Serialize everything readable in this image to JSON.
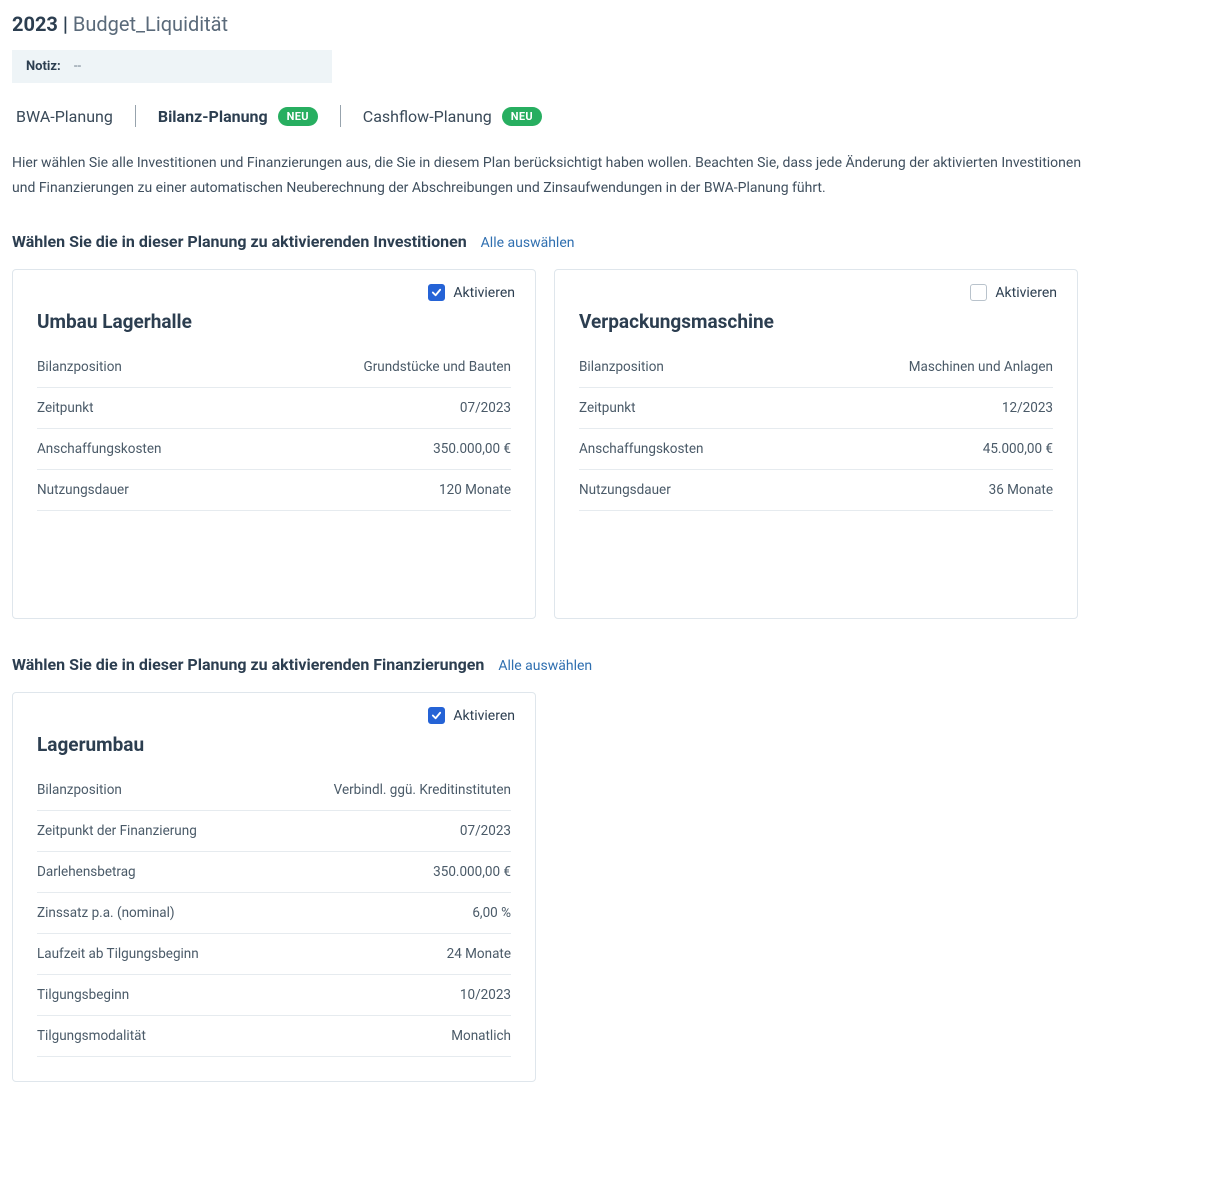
{
  "header": {
    "year": "2023",
    "sep": " | ",
    "title": "Budget_Liquidität",
    "note_label": "Notiz:",
    "note_value": "--"
  },
  "tabs": [
    {
      "label": "BWA-Planung",
      "active": false,
      "badge": null
    },
    {
      "label": "Bilanz-Planung",
      "active": true,
      "badge": "NEU"
    },
    {
      "label": "Cashflow-Planung",
      "active": false,
      "badge": "NEU"
    }
  ],
  "intro": "Hier wählen Sie alle Investitionen und Finanzierungen aus, die Sie in diesem Plan berücksichtigt haben wollen. Beachten Sie, dass jede Änderung der aktivierten Investitionen und Finanzierungen zu einer automatischen Neuberechnung der Abschreibungen und Zinsaufwendungen in der BWA-Planung führt.",
  "sections": {
    "investments": {
      "heading": "Wählen Sie die in dieser Planung zu aktivierenden Investitionen",
      "select_all": "Alle auswählen",
      "activate_label": "Aktivieren",
      "cards": [
        {
          "title": "Umbau Lagerhalle",
          "checked": true,
          "rows": [
            {
              "k": "Bilanzposition",
              "v": "Grundstücke und Bauten"
            },
            {
              "k": "Zeitpunkt",
              "v": "07/2023"
            },
            {
              "k": "Anschaffungskosten",
              "v": "350.000,00 €"
            },
            {
              "k": "Nutzungsdauer",
              "v": "120 Monate"
            }
          ]
        },
        {
          "title": "Verpackungsmaschine",
          "checked": false,
          "rows": [
            {
              "k": "Bilanzposition",
              "v": "Maschinen und Anlagen"
            },
            {
              "k": "Zeitpunkt",
              "v": "12/2023"
            },
            {
              "k": "Anschaffungskosten",
              "v": "45.000,00 €"
            },
            {
              "k": "Nutzungsdauer",
              "v": "36 Monate"
            }
          ]
        }
      ]
    },
    "financings": {
      "heading": "Wählen Sie die in dieser Planung zu aktivierenden Finanzierungen",
      "select_all": "Alle auswählen",
      "activate_label": "Aktivieren",
      "cards": [
        {
          "title": "Lagerumbau",
          "checked": true,
          "rows": [
            {
              "k": "Bilanzposition",
              "v": "Verbindl. ggü. Kreditinstituten"
            },
            {
              "k": "Zeitpunkt der Finanzierung",
              "v": "07/2023"
            },
            {
              "k": "Darlehensbetrag",
              "v": "350.000,00 €"
            },
            {
              "k": "Zinssatz p.a. (nominal)",
              "v": "6,00 %"
            },
            {
              "k": "Laufzeit ab Tilgungsbeginn",
              "v": "24 Monate"
            },
            {
              "k": "Tilgungsbeginn",
              "v": "10/2023"
            },
            {
              "k": "Tilgungsmodalität",
              "v": "Monatlich"
            }
          ]
        }
      ]
    }
  }
}
